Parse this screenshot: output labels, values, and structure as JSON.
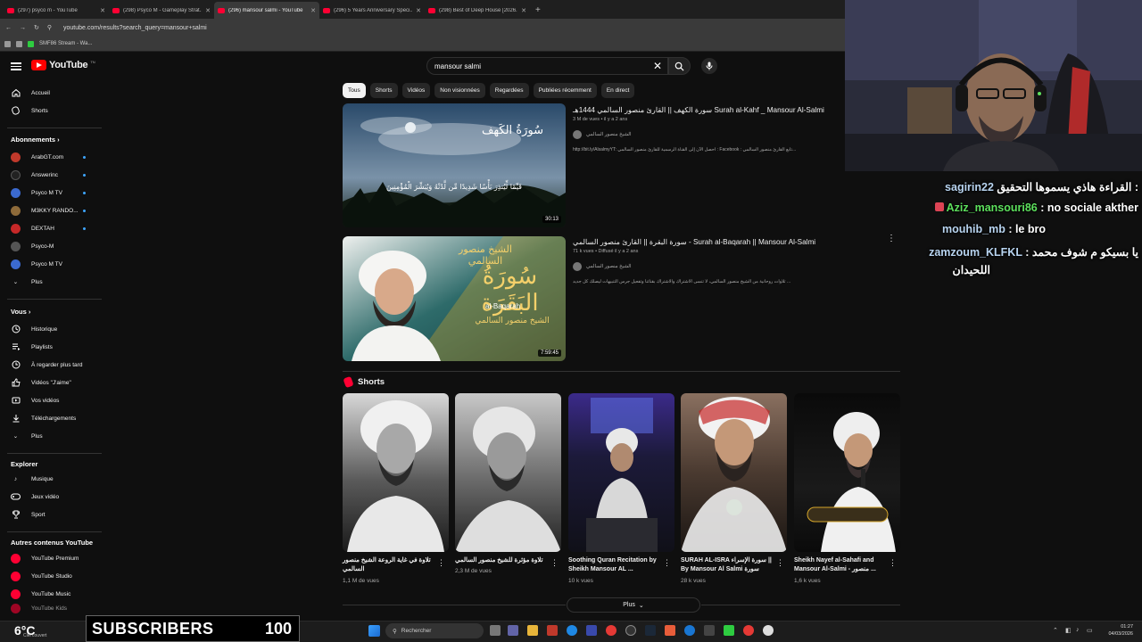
{
  "browser": {
    "tabs": [
      {
        "title": "(297) psyco m - YouTube",
        "active": false
      },
      {
        "title": "(298) Psyco M - Gameplay Strat...",
        "active": false
      },
      {
        "title": "(296) mansour salmi - YouTube",
        "active": true
      },
      {
        "title": "(296) 5 Years Anniversary Speci...",
        "active": false
      },
      {
        "title": "(298) Best of Deep House [2026...",
        "active": false
      }
    ],
    "new_tab": "+",
    "url": "youtube.com/results?search_query=mansour+salmi",
    "bookmark": "SMF86 Stream - Wa..."
  },
  "header": {
    "logo": "YouTube",
    "logo_tm": "TN",
    "search_value": "mansour salmi",
    "clear": "✕"
  },
  "sidebar": {
    "main": [
      {
        "label": "Accueil",
        "icon": "home-icon"
      },
      {
        "label": "Shorts",
        "icon": "shorts-icon"
      }
    ],
    "subs_title": "Abonnements",
    "subs": [
      {
        "label": "ArabGT.com",
        "color": "#c0392b"
      },
      {
        "label": "Answerinc",
        "color": "#222222"
      },
      {
        "label": "Psyco M TV",
        "color": "#3b6ad0"
      },
      {
        "label": "M3KKY RANDO...",
        "color": "#8e6b3a"
      },
      {
        "label": "DEXTAH",
        "color": "#c62828"
      },
      {
        "label": "Psyco-M",
        "color": "#555555"
      },
      {
        "label": "Psyco M TV",
        "color": "#3b6ad0"
      }
    ],
    "subs_more": "Plus",
    "you_title": "Vous",
    "you": [
      {
        "label": "Historique",
        "icon": "history-icon"
      },
      {
        "label": "Playlists",
        "icon": "playlists-icon"
      },
      {
        "label": "À regarder plus tard",
        "icon": "watch-later-icon"
      },
      {
        "label": "Vidéos \"J'aime\"",
        "icon": "like-icon"
      },
      {
        "label": "Vos vidéos",
        "icon": "your-videos-icon"
      },
      {
        "label": "Téléchargements",
        "icon": "download-icon"
      }
    ],
    "you_more": "Plus",
    "explore_title": "Explorer",
    "explore": [
      {
        "label": "Musique",
        "icon": "music-icon"
      },
      {
        "label": "Jeux vidéo",
        "icon": "gaming-icon"
      },
      {
        "label": "Sport",
        "icon": "trophy-icon"
      }
    ],
    "other_title": "Autres contenus YouTube",
    "other": [
      {
        "label": "YouTube Premium"
      },
      {
        "label": "YouTube Studio"
      },
      {
        "label": "YouTube Music"
      },
      {
        "label": "YouTube Kids"
      }
    ]
  },
  "chips": [
    "Tous",
    "Shorts",
    "Vidéos",
    "Non visionnées",
    "Regardées",
    "Publiées récemment",
    "En direct"
  ],
  "videos": [
    {
      "title": "سورة الكهف || القارئ منصور السالمي 1444هـ Surah al-Kahf _ Mansour Al-Salmi",
      "meta": "3 M de vues • il y a 2 ans",
      "channel": "الشيخ منصور السالمي",
      "desc": "http://bit.ly/AlsalmyYT: احصل الآن إلى القناة الرسمية للقارئ منصور السالمي : Facebook : تابع القارئ منصور السالمي...",
      "duration": "30:13"
    },
    {
      "title": "سورة البقرة || القارئ منصور السالمي - Surah al-Baqarah || Mansour Al-Salmi",
      "meta": "71 k vues • Diffusé il y a 2 ans",
      "channel": "الشيخ منصور السالمي",
      "desc": "تلاوات روحانية من الشيخ منصور السالمي، لا تنسى الاشتراك والاشتراك بقناتنا وتفعيل جرس التنبيهات ليصلك كل جديد ...",
      "duration": "7:59:45",
      "thumb_title": "سُورَةُ البَقَرَة",
      "thumb_sub": "al-Baqarah",
      "thumb_name": "الشيخ منصور السالمي"
    }
  ],
  "shorts": {
    "title": "Shorts",
    "items": [
      {
        "title": "تلاوة في غاية الروعة الشيخ منصور السالمي",
        "views": "1,1 M de vues"
      },
      {
        "title": "تلاوة مؤثرة للشيخ منصور السالمي",
        "views": "2,3 M de vues"
      },
      {
        "title": "Soothing Quran Recitation by Sheikh Mansour AL ...",
        "views": "10 k vues"
      },
      {
        "title": "SURAH AL-ISRA سورة الإسراء || By Mansour Al Salmi سورة",
        "views": "28 k vues"
      },
      {
        "title": "Sheikh Nayef al-Sahafi and Mansour Al-Salmi - منصور ...",
        "views": "1,6 k vues"
      }
    ],
    "more": "Plus"
  },
  "chat": [
    {
      "user": "sagirin22",
      "msg": "القراءة هاذي يسموها التحقيق :",
      "color": "#b8d4f0"
    },
    {
      "user": "Aziz_mansouri86",
      "msg": ": no sociale akther",
      "color": "#5de05d"
    },
    {
      "user": "mouhib_mb",
      "msg": ": le bro",
      "color": "#b8d4f0"
    },
    {
      "user": "zamzoum_KLFKL",
      "msg": ": يا بسيكو م شوف محمد",
      "color": "#b8d4f0"
    },
    {
      "user": "",
      "msg": "اللحيدان",
      "color": "#b8d4f0"
    }
  ],
  "overlay": {
    "subscribers_label": "SUBSCRIBERS",
    "subscribers_count": "100"
  },
  "taskbar": {
    "weather_temp": "6°C",
    "weather_desc": "Ciel couvert",
    "search": "Rechercher",
    "time": "01:27",
    "date": "04/03/2026"
  }
}
